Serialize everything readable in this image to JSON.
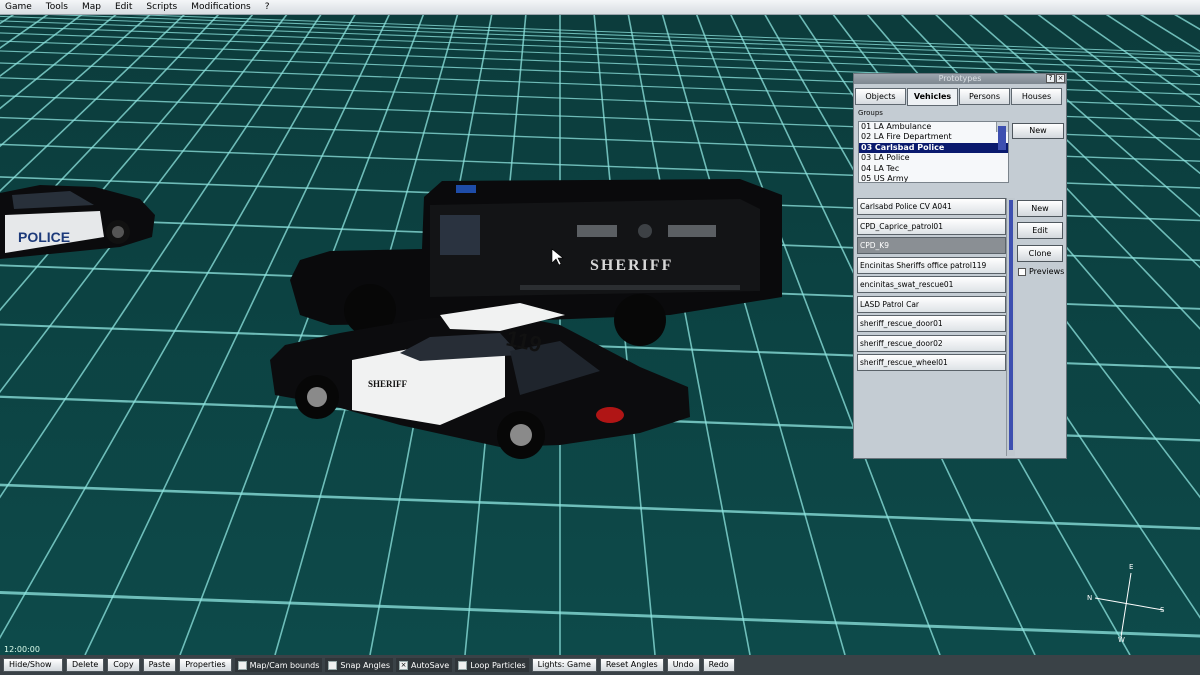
{
  "menu": [
    "Game",
    "Tools",
    "Map",
    "Edit",
    "Scripts",
    "Modifications",
    "?"
  ],
  "scene": {
    "time": "12:00:00",
    "compass": {
      "n": "N",
      "s": "S",
      "e": "E",
      "w": "W"
    },
    "vehicle_texts": {
      "police": "POLICE",
      "sheriff": "SHERIFF",
      "unit_number": "119"
    }
  },
  "panel": {
    "title": "Prototypes",
    "title_help": "?",
    "title_close": "×",
    "tabs": [
      "Objects",
      "Vehicles",
      "Persons",
      "Houses"
    ],
    "active_tab": "Vehicles",
    "groups_label": "Groups",
    "groups": [
      "01 LA Ambulance",
      "02 LA Fire Department",
      "03 Carlsbad Police",
      "03 LA Police",
      "04 LA Tec",
      "05 US Army"
    ],
    "selected_group": "03 Carlsbad Police",
    "groups_new_label": "New",
    "vehicles": [
      "Carlsabd Police CV A041",
      "CPD_Caprice_patrol01",
      "CPD_K9",
      "Encinitas Sheriffs office patrol119",
      "encinitas_swat_rescue01",
      "LASD Patrol Car",
      "sheriff_rescue_door01",
      "sheriff_rescue_door02",
      "sheriff_rescue_wheel01"
    ],
    "selected_vehicle": "CPD_K9",
    "buttons": {
      "new": "New",
      "edit": "Edit",
      "clone": "Clone"
    },
    "previews_label": "Previews",
    "previews_checked": false
  },
  "statusbar": {
    "hide_show": "Hide/Show",
    "delete": "Delete",
    "copy": "Copy",
    "paste": "Paste",
    "properties": "Properties",
    "map_cam_bounds": {
      "label": "Map/Cam bounds",
      "checked": false
    },
    "snap_angles": {
      "label": "Snap Angles",
      "checked": false
    },
    "autosave": {
      "label": "AutoSave",
      "checked": true
    },
    "loop_particles": {
      "label": "Loop Particles",
      "checked": false
    },
    "lights": "Lights: Game",
    "reset_angles": "Reset Angles",
    "undo": "Undo",
    "redo": "Redo"
  },
  "colors": {
    "grid_line": "#8fe6e0",
    "ground": "#0d4a4a",
    "selection": "#0a1a6e"
  }
}
